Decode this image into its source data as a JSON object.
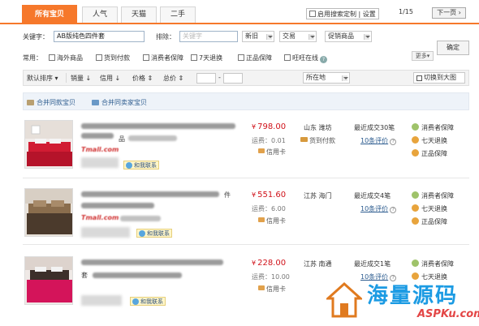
{
  "tabs": [
    {
      "label": "所有宝贝",
      "active": true
    },
    {
      "label": "人气",
      "active": false
    },
    {
      "label": "天猫",
      "active": false
    },
    {
      "label": "二手",
      "active": false
    }
  ],
  "custom_search": {
    "label": "启用搜索定制",
    "settings": "设置"
  },
  "pagination": {
    "indicator": "1/15",
    "next_label": "下一页"
  },
  "filters": {
    "keyword_label": "关键字：",
    "keyword_value": "AB版纯色四件套",
    "exclude_label": "排除：",
    "exclude_placeholder": "关键字",
    "dropdowns": [
      "新旧",
      "交易",
      "促销商品"
    ],
    "confirm_label": "确定",
    "common_label": "常用：",
    "checkboxes": [
      "海外商品",
      "货到付款",
      "消费者保障",
      "7天退换",
      "正品保障",
      "旺旺在线"
    ],
    "more_label": "更多"
  },
  "sortbar": {
    "default": "默认排序",
    "sales": "销量",
    "credit": "信用",
    "price": "价格",
    "total": "总价",
    "range_sep": "-",
    "location": "所在地",
    "big_image": "切换到大图"
  },
  "merge": {
    "same_item": "合并同款宝贝",
    "same_seller": "合并同卖家宝贝"
  },
  "products": [
    {
      "title_fragment": "品",
      "brand": "Tmall.com",
      "contact": "和我联系",
      "price": "798.00",
      "shipping": "运费：0.01",
      "credit": "信用卡",
      "location": "山东 潍坊",
      "cod": "货到付款",
      "sold": "最近成交30笔",
      "reviews": "10条评价",
      "services": [
        "消费者保障",
        "七天退换",
        "正品保障"
      ]
    },
    {
      "title_fragment": "件",
      "brand": "Tmall.com",
      "contact": "和我联系",
      "price": "551.60",
      "shipping": "运费：6.00",
      "credit": "信用卡",
      "location": "江苏 海门",
      "cod": "",
      "sold": "最近成交4笔",
      "reviews": "10条评价",
      "services": [
        "消费者保障",
        "七天退换",
        "正品保障"
      ]
    },
    {
      "title_fragment": "套",
      "brand": "",
      "contact": "和我联系",
      "price": "228.00",
      "shipping": "运费：10.00",
      "credit": "信用卡",
      "location": "江苏 南通",
      "cod": "",
      "sold": "最近成交1笔",
      "reviews": "10条评价",
      "services": [
        "消费者保障",
        "七天退换"
      ]
    }
  ],
  "watermark": {
    "text": "海量源码",
    "url": "ASPKu.com"
  },
  "colors": {
    "accent": "#f6782b",
    "price": "#d0121a",
    "link": "#2d5c8f"
  }
}
